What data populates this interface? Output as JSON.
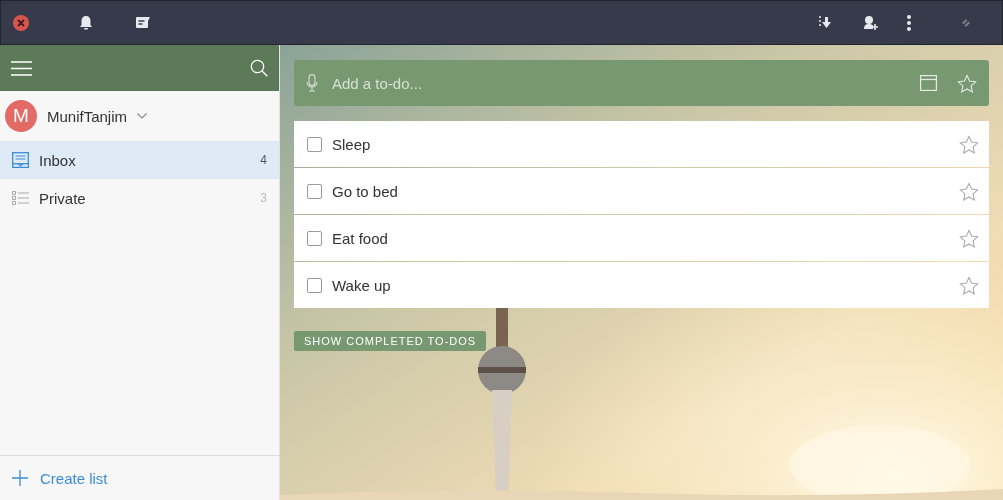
{
  "sidebar": {
    "user": {
      "initial": "M",
      "name": "MunifTanjim"
    },
    "lists": [
      {
        "kind": "inbox",
        "label": "Inbox",
        "count": "4",
        "selected": true
      },
      {
        "kind": "list",
        "label": "Private",
        "count": "3",
        "selected": false
      }
    ],
    "create_list": "Create list"
  },
  "main": {
    "add_todo": {
      "placeholder": "Add a to-do..."
    },
    "todos": [
      {
        "title": "Sleep",
        "checked": false,
        "starred": false
      },
      {
        "title": "Go to bed",
        "checked": false,
        "starred": false
      },
      {
        "title": "Eat food",
        "checked": false,
        "starred": false
      },
      {
        "title": "Wake up",
        "checked": false,
        "starred": false
      }
    ],
    "show_completed": "SHOW COMPLETED TO-DOS"
  }
}
